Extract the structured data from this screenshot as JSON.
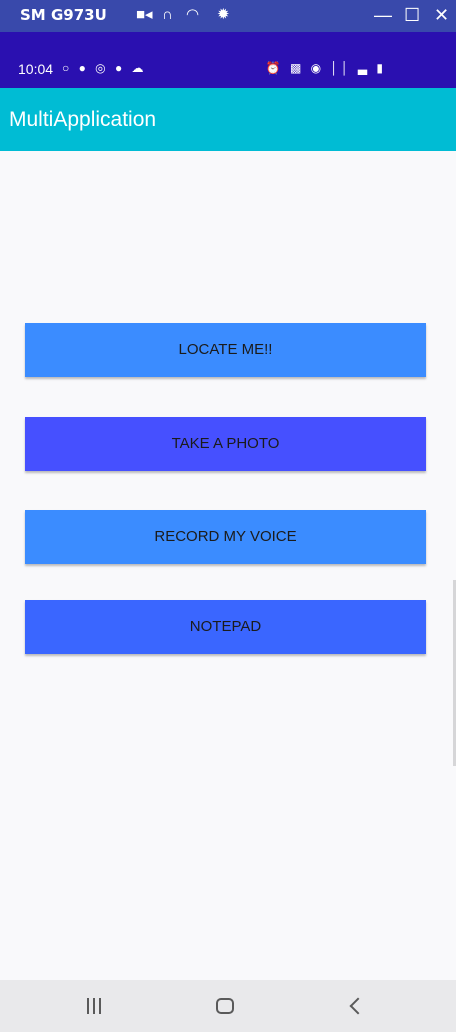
{
  "window": {
    "title": "SM G973U",
    "icons": [
      "camera-icon",
      "headphones-icon",
      "wifi-icon",
      "settings-icon"
    ],
    "controls": {
      "minimize": "—",
      "maximize": "☐",
      "close": "✕"
    }
  },
  "status_bar": {
    "time": "10:04",
    "left_icons": "○ ● ◎ ● ☁",
    "right_icons": "⏰ ▩ ◉ ││ ▃ ▮"
  },
  "app_bar": {
    "title": "MultiApplication"
  },
  "buttons": {
    "locate": "LOCATE ME!!",
    "photo": "TAKE A PHOTO",
    "voice": "RECORD MY VOICE",
    "notepad": "NOTEPAD"
  },
  "colors": {
    "window_bar": "#3949ab",
    "status_bar": "#2a10b0",
    "app_bar": "#00bcd4",
    "button_light_blue": "#3b8cff",
    "button_indigo": "#4650ff"
  },
  "nav_bar": {
    "recent": "recent-apps-icon",
    "home": "home-icon",
    "back": "back-icon"
  }
}
